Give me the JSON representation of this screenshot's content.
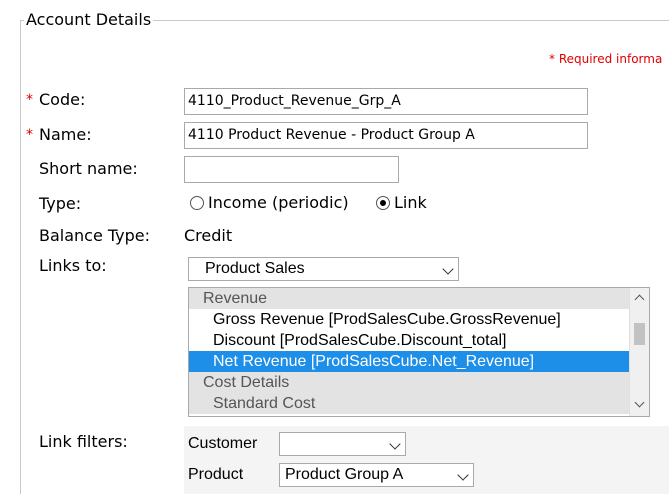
{
  "section": {
    "title": "Account Details"
  },
  "required_note": "* Required informa",
  "required_marker": "*",
  "labels": {
    "code": "Code:",
    "name": "Name:",
    "short_name": "Short name:",
    "type": "Type:",
    "balance_type": "Balance Type:",
    "links_to": "Links to:",
    "link_filters": "Link filters:"
  },
  "fields": {
    "code": "4110_Product_Revenue_Grp_A",
    "name": "4110 Product Revenue - Product Group A",
    "short_name": ""
  },
  "type_options": [
    {
      "label": "Income (periodic)",
      "checked": false
    },
    {
      "label": "Link",
      "checked": true
    }
  ],
  "balance_type_value": "Credit",
  "links_to_select": "Product Sales",
  "links_list": [
    {
      "label": "Revenue",
      "kind": "group"
    },
    {
      "label": "Gross Revenue [ProdSalesCube.GrossRevenue]",
      "kind": "option"
    },
    {
      "label": "Discount [ProdSalesCube.Discount_total]",
      "kind": "option"
    },
    {
      "label": "Net Revenue [ProdSalesCube.Net_Revenue]",
      "kind": "selected"
    },
    {
      "label": "Cost Details",
      "kind": "group"
    },
    {
      "label": "Standard Cost",
      "kind": "disabled"
    }
  ],
  "filters": {
    "customer_label": "Customer",
    "customer_value": "",
    "product_label": "Product",
    "product_value": "Product Group A"
  },
  "icons": {
    "dropdown": "chevron-down-icon",
    "scroll_up": "chevron-up-icon",
    "scroll_down": "chevron-down-icon"
  },
  "colors": {
    "required": "#e00000",
    "selection": "#1e8fe8",
    "group_bg": "#e3e3e3"
  }
}
